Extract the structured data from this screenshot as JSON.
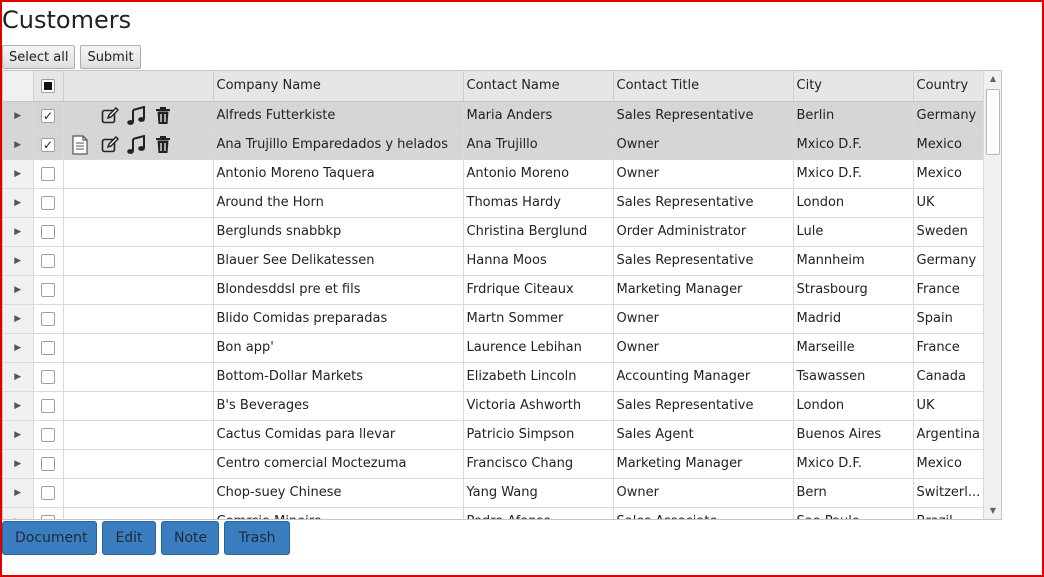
{
  "page": {
    "title": "Customers"
  },
  "toolbar": {
    "select_all": "Select all",
    "submit": "Submit"
  },
  "grid": {
    "columns": [
      "Company Name",
      "Contact Name",
      "Contact Title",
      "City",
      "Country"
    ],
    "header_checkbox": "checked",
    "rows": [
      {
        "selected": true,
        "checked": true,
        "icons": [
          "edit-icon",
          "music-note-icon",
          "trash-icon"
        ],
        "company": "Alfreds Futterkiste",
        "contact": "Maria Anders",
        "title": "Sales Representative",
        "city": "Berlin",
        "country": "Germany"
      },
      {
        "selected": true,
        "checked": true,
        "icons": [
          "document-icon",
          "edit-icon",
          "music-note-icon",
          "trash-icon"
        ],
        "company": "Ana Trujillo Emparedados y helados",
        "contact": "Ana Trujillo",
        "title": "Owner",
        "city": "Mxico D.F.",
        "country": "Mexico"
      },
      {
        "selected": false,
        "checked": false,
        "icons": [],
        "company": "Antonio Moreno Taquera",
        "contact": "Antonio Moreno",
        "title": "Owner",
        "city": "Mxico D.F.",
        "country": "Mexico"
      },
      {
        "selected": false,
        "checked": false,
        "icons": [],
        "company": "Around the Horn",
        "contact": "Thomas Hardy",
        "title": "Sales Representative",
        "city": "London",
        "country": "UK"
      },
      {
        "selected": false,
        "checked": false,
        "icons": [],
        "company": "Berglunds snabbkp",
        "contact": "Christina Berglund",
        "title": "Order Administrator",
        "city": "Lule",
        "country": "Sweden"
      },
      {
        "selected": false,
        "checked": false,
        "icons": [],
        "company": "Blauer See Delikatessen",
        "contact": "Hanna Moos",
        "title": "Sales Representative",
        "city": "Mannheim",
        "country": "Germany"
      },
      {
        "selected": false,
        "checked": false,
        "icons": [],
        "company": "Blondesddsl pre et fils",
        "contact": "Frdrique Citeaux",
        "title": "Marketing Manager",
        "city": "Strasbourg",
        "country": "France"
      },
      {
        "selected": false,
        "checked": false,
        "icons": [],
        "company": "Blido Comidas preparadas",
        "contact": "Martn Sommer",
        "title": "Owner",
        "city": "Madrid",
        "country": "Spain"
      },
      {
        "selected": false,
        "checked": false,
        "icons": [],
        "company": "Bon app'",
        "contact": "Laurence Lebihan",
        "title": "Owner",
        "city": "Marseille",
        "country": "France"
      },
      {
        "selected": false,
        "checked": false,
        "icons": [],
        "company": "Bottom-Dollar Markets",
        "contact": "Elizabeth Lincoln",
        "title": "Accounting Manager",
        "city": "Tsawassen",
        "country": "Canada"
      },
      {
        "selected": false,
        "checked": false,
        "icons": [],
        "company": "B's Beverages",
        "contact": "Victoria Ashworth",
        "title": "Sales Representative",
        "city": "London",
        "country": "UK"
      },
      {
        "selected": false,
        "checked": false,
        "icons": [],
        "company": "Cactus Comidas para llevar",
        "contact": "Patricio Simpson",
        "title": "Sales Agent",
        "city": "Buenos Aires",
        "country": "Argentina"
      },
      {
        "selected": false,
        "checked": false,
        "icons": [],
        "company": "Centro comercial Moctezuma",
        "contact": "Francisco Chang",
        "title": "Marketing Manager",
        "city": "Mxico D.F.",
        "country": "Mexico"
      },
      {
        "selected": false,
        "checked": false,
        "icons": [],
        "company": "Chop-suey Chinese",
        "contact": "Yang Wang",
        "title": "Owner",
        "city": "Bern",
        "country": "Switzerl..."
      },
      {
        "selected": false,
        "checked": false,
        "icons": [],
        "company": "Comrcio Mineiro",
        "contact": "Pedro Afonso",
        "title": "Sales Associate",
        "city": "Sao Paulo",
        "country": "Brazil"
      }
    ]
  },
  "actions": {
    "document": "Document",
    "edit": "Edit",
    "note": "Note",
    "trash": "Trash"
  },
  "colors": {
    "frame": "#e00000",
    "selected_row": "#d6d6d6",
    "header": "#e6e6e6",
    "action_button": "#3a7ebf"
  }
}
